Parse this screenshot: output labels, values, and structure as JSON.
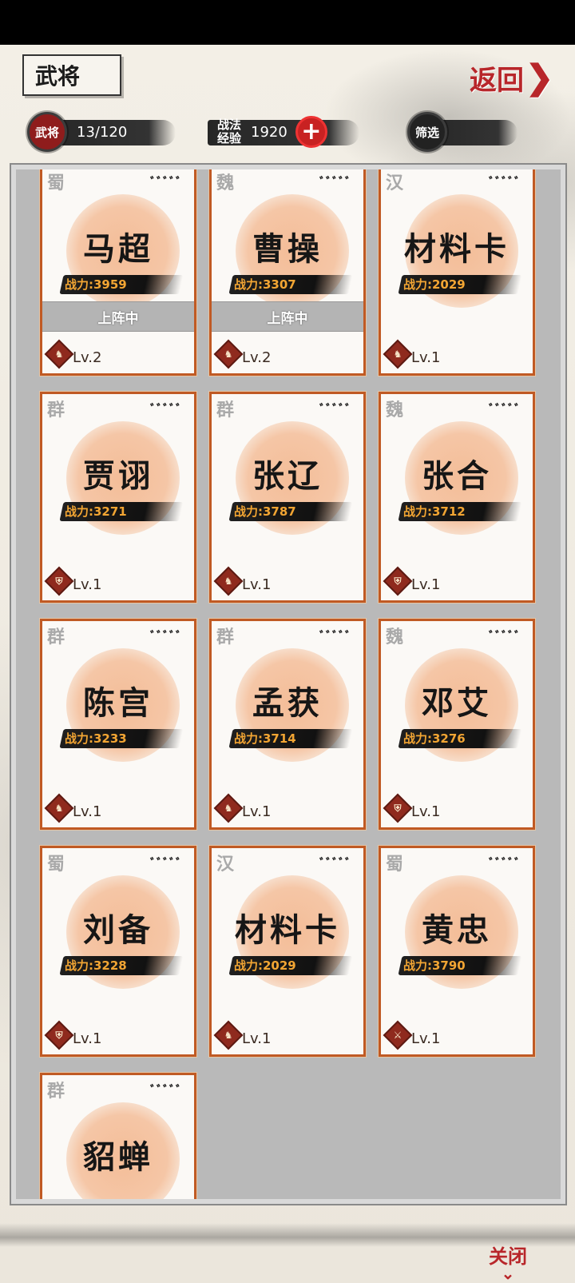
{
  "header": {
    "title": "武将",
    "back_label": "返回",
    "back_arrow_icon": "chevron-right-icon"
  },
  "stats": {
    "generals_badge": "武将",
    "generals_count": "13/120",
    "tactics_label_line1": "战法",
    "tactics_label_line2": "经验",
    "tactics_exp": "1920",
    "add_icon": "plus-icon",
    "filter_label": "筛选"
  },
  "cards": [
    {
      "faction": "蜀",
      "stars": "ﾞﾞﾞﾞﾞ",
      "name": "马超",
      "power": "战力:3959",
      "deployed": "上阵中",
      "lv": "Lv.2",
      "icon": "horse-icon"
    },
    {
      "faction": "魏",
      "stars": "ﾞﾞﾞﾞﾞ",
      "name": "曹操",
      "power": "战力:3307",
      "deployed": "上阵中",
      "lv": "Lv.2",
      "icon": "horse-icon"
    },
    {
      "faction": "汉",
      "stars": "ﾞﾞﾞﾞﾞ",
      "name": "材料卡",
      "power": "战力:2029",
      "deployed": "",
      "lv": "Lv.1",
      "icon": "horse-icon"
    },
    {
      "faction": "群",
      "stars": "ﾞﾞﾞﾞﾞ",
      "name": "贾诩",
      "power": "战力:3271",
      "deployed": "",
      "lv": "Lv.1",
      "icon": "shield-icon"
    },
    {
      "faction": "群",
      "stars": "ﾞﾞﾞﾞﾞ",
      "name": "张辽",
      "power": "战力:3787",
      "deployed": "",
      "lv": "Lv.1",
      "icon": "horse-icon"
    },
    {
      "faction": "魏",
      "stars": "ﾞﾞﾞﾞﾞ",
      "name": "张合",
      "power": "战力:3712",
      "deployed": "",
      "lv": "Lv.1",
      "icon": "shield-icon"
    },
    {
      "faction": "群",
      "stars": "ﾞﾞﾞﾞﾞ",
      "name": "陈宫",
      "power": "战力:3233",
      "deployed": "",
      "lv": "Lv.1",
      "icon": "horse-icon"
    },
    {
      "faction": "群",
      "stars": "ﾞﾞﾞﾞﾞ",
      "name": "孟获",
      "power": "战力:3714",
      "deployed": "",
      "lv": "Lv.1",
      "icon": "horse-icon"
    },
    {
      "faction": "魏",
      "stars": "ﾞﾞﾞﾞﾞ",
      "name": "邓艾",
      "power": "战力:3276",
      "deployed": "",
      "lv": "Lv.1",
      "icon": "shield-icon"
    },
    {
      "faction": "蜀",
      "stars": "ﾞﾞﾞﾞﾞ",
      "name": "刘备",
      "power": "战力:3228",
      "deployed": "",
      "lv": "Lv.1",
      "icon": "shield-icon"
    },
    {
      "faction": "汉",
      "stars": "ﾞﾞﾞﾞﾞ",
      "name": "材料卡",
      "power": "战力:2029",
      "deployed": "",
      "lv": "Lv.1",
      "icon": "horse-icon"
    },
    {
      "faction": "蜀",
      "stars": "ﾞﾞﾞﾞﾞ",
      "name": "黄忠",
      "power": "战力:3790",
      "deployed": "",
      "lv": "Lv.1",
      "icon": "bow-icon"
    },
    {
      "faction": "群",
      "stars": "ﾞﾞﾞﾞﾞ",
      "name": "貂蝉",
      "power": "",
      "deployed": "",
      "lv": "",
      "icon": ""
    }
  ],
  "footer": {
    "close_label": "关闭",
    "close_icon": "chevron-down-icon"
  },
  "colors": {
    "card_border": "#c05a24",
    "power_text": "#f2a533",
    "accent_red": "#b8262a"
  }
}
